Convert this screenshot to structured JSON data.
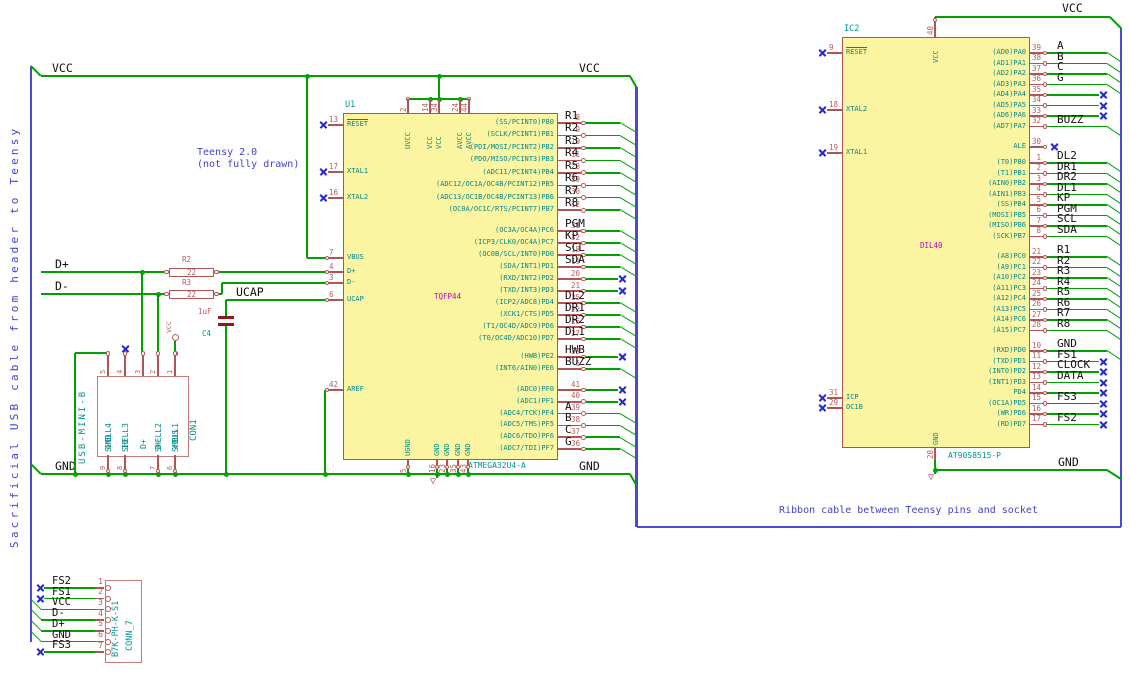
{
  "notes": {
    "sacrificial": "Sacrificial USB cable from header to Teensy",
    "teensy1": "Teensy 2.0",
    "teensy2": "(not fully drawn)",
    "ribbon": "Ribbon cable between Teensy pins and socket"
  },
  "nets": {
    "vcc": "VCC",
    "gnd": "GND",
    "dplus": "D+",
    "dminus": "D-",
    "ucap": "UCAP"
  },
  "colors": {
    "wire_green": "#00A000",
    "bus_blue": "#4A4AD2",
    "body_fill": "#FBF4A1",
    "outline_red": "#B05555",
    "pin_number_red": "#B85A5A",
    "pin_name_teal": "#008B8B",
    "reference_cyan": "#009494",
    "package_magenta": "#BF00BF",
    "note_blue": "#4343CC",
    "net_label_black": "#101010",
    "no_connect_blue": "#2525D2"
  },
  "u1": {
    "ref": "U1",
    "part": "ATMEGA32U4-A",
    "package": "TQFP44",
    "top_pins": [
      {
        "n": "2",
        "name": "UVCC"
      },
      {
        "n": "14",
        "name": "VCC"
      },
      {
        "n": "34",
        "name": "VCC"
      },
      {
        "n": "24",
        "name": "AVCC"
      },
      {
        "n": "44",
        "name": "AVCC"
      }
    ],
    "bottom_pins": [
      {
        "n": "5",
        "name": "UGND"
      },
      {
        "n": "16",
        "name": "GND"
      },
      {
        "n": "23",
        "name": "GND"
      },
      {
        "n": "35",
        "name": "GND"
      },
      {
        "n": "43",
        "name": "GND"
      }
    ],
    "left_pins": [
      {
        "n": "13",
        "name": "RESET",
        "conn": "nc",
        "ovl": true
      },
      {
        "n": "17",
        "name": "XTAL1",
        "conn": "nc"
      },
      {
        "n": "16",
        "name": "XTAL2",
        "conn": "nc"
      },
      {
        "n": "7",
        "name": "VBUS",
        "conn": "wire"
      },
      {
        "n": "4",
        "name": "D+",
        "conn": "wire"
      },
      {
        "n": "3",
        "name": "D-",
        "conn": "wire"
      },
      {
        "n": "6",
        "name": "UCAP",
        "conn": "wire"
      },
      {
        "n": "42",
        "name": "AREF",
        "conn": "wire"
      }
    ],
    "right_groups": [
      [
        {
          "n": "8",
          "name": "(SS/PCINT0)PB0",
          "net": "R1",
          "conn": "bus"
        },
        {
          "n": "9",
          "name": "(SCLK/PCINT1)PB1",
          "net": "R2",
          "conn": "bus"
        },
        {
          "n": "10",
          "name": "(PDI/MOSI/PCINT2)PB2",
          "net": "R3",
          "conn": "bus"
        },
        {
          "n": "11",
          "name": "(PDO/MISO/PCINT3)PB3",
          "net": "R4",
          "conn": "bus"
        },
        {
          "n": "28",
          "name": "(ADC11/PCINT4)PB4",
          "net": "R5",
          "conn": "bus"
        },
        {
          "n": "29",
          "name": "(ADC12/OC1A/OC4B/PCINT12)PB5",
          "net": "R6",
          "conn": "bus"
        },
        {
          "n": "30",
          "name": "(ADC13/OC1B/OC4B/PCINT13)PB6",
          "net": "R7",
          "conn": "bus"
        },
        {
          "n": "12",
          "name": "(OC0A/OC1C/RTS/PCINT7)PB7",
          "net": "R8",
          "conn": "bus"
        }
      ],
      [
        {
          "n": "31",
          "name": "(OC3A/OC4A)PC6",
          "net": "PGM",
          "conn": "bus"
        },
        {
          "n": "32",
          "name": "(ICP3/CLK0/OC4A)PC7",
          "net": "KP",
          "conn": "bus"
        }
      ],
      [
        {
          "n": "18",
          "name": "(OC0B/SCL/INT0)PD0",
          "net": "SCL",
          "conn": "bus"
        },
        {
          "n": "19",
          "name": "(SDA/INT1)PD1",
          "net": "SDA",
          "conn": "bus"
        },
        {
          "n": "20",
          "name": "(RXD/INT2)PD2",
          "net": "",
          "conn": "nc"
        },
        {
          "n": "21",
          "name": "(TXD/INT3)PD3",
          "net": "",
          "conn": "nc"
        },
        {
          "n": "25",
          "name": "(ICP2/ADC8)PD4",
          "net": "DL2",
          "conn": "bus"
        },
        {
          "n": "22",
          "name": "(XCK1/CTS)PD5",
          "net": "DR1",
          "conn": "bus"
        },
        {
          "n": "26",
          "name": "(T1/OC4D/ADC9)PD6",
          "net": "DR2",
          "conn": "bus"
        },
        {
          "n": "27",
          "name": "(T0/OC4D/ADC10)PD7",
          "net": "DL1",
          "conn": "bus"
        }
      ],
      [
        {
          "n": "33",
          "name": "(HWB)PE2",
          "net": "HWB",
          "conn": "nc"
        },
        {
          "n": "1",
          "name": "(INT6/AIN0)PE6",
          "net": "BUZZ",
          "conn": "bus"
        }
      ],
      [
        {
          "n": "41",
          "name": "(ADC0)PF0",
          "net": "",
          "conn": "nc"
        },
        {
          "n": "40",
          "name": "(ADC1)PF1",
          "net": "",
          "conn": "nc"
        },
        {
          "n": "39",
          "name": "(ADC4/TCK)PF4",
          "net": "A",
          "conn": "bus"
        },
        {
          "n": "38",
          "name": "(ADC5/TMS)PF5",
          "net": "B",
          "conn": "bus"
        },
        {
          "n": "37",
          "name": "(ADC6/TDO)PF6",
          "net": "C",
          "conn": "bus"
        },
        {
          "n": "36",
          "name": "(ADC7/TDI)PF7",
          "net": "G",
          "conn": "bus"
        }
      ]
    ]
  },
  "ic2": {
    "ref": "IC2",
    "part": "AT90S8515-P",
    "package": "DIL40",
    "top_pins": [
      {
        "n": "40",
        "name": "VCC"
      }
    ],
    "bottom_pins": [
      {
        "n": "20",
        "name": "GND"
      }
    ],
    "left_pins": [
      {
        "n": "9",
        "name": "RESET",
        "conn": "nc",
        "ovl": true
      },
      {
        "n": "18",
        "name": "XTAL2",
        "conn": "nc"
      },
      {
        "n": "19",
        "name": "XTAL1",
        "conn": "nc"
      },
      {
        "n": "31",
        "name": "ICP",
        "conn": "nc"
      },
      {
        "n": "29",
        "name": "OC1B",
        "conn": "nc"
      }
    ],
    "right_groups": [
      [
        {
          "n": "39",
          "name": "(AD0)PA0",
          "net": "A",
          "conn": "bus"
        },
        {
          "n": "38",
          "name": "(AD1)PA1",
          "net": "B",
          "conn": "bus"
        },
        {
          "n": "37",
          "name": "(AD2)PA2",
          "net": "C",
          "conn": "bus"
        },
        {
          "n": "36",
          "name": "(AD3)PA3",
          "net": "G",
          "conn": "bus"
        },
        {
          "n": "35",
          "name": "(AD4)PA4",
          "net": "",
          "conn": "nc"
        },
        {
          "n": "34",
          "name": "(AD5)PA5",
          "net": "",
          "conn": "nc"
        },
        {
          "n": "33",
          "name": "(AD6)PA6",
          "net": "",
          "conn": "nc"
        },
        {
          "n": "32",
          "name": "(AD7)PA7",
          "net": "BUZZ",
          "conn": "bus"
        }
      ],
      [
        {
          "n": "30",
          "name": "ALE",
          "net": "",
          "conn": "ncshort"
        }
      ],
      [
        {
          "n": "1",
          "name": "(T0)PB0",
          "net": "DL2",
          "conn": "bus"
        },
        {
          "n": "2",
          "name": "(T1)PB1",
          "net": "DR1",
          "conn": "bus"
        },
        {
          "n": "3",
          "name": "(AIN0)PB2",
          "net": "DR2",
          "conn": "bus"
        },
        {
          "n": "4",
          "name": "(AIN1)PB3",
          "net": "DL1",
          "conn": "bus"
        },
        {
          "n": "5",
          "name": "(SS)PB4",
          "net": "KP",
          "conn": "bus"
        },
        {
          "n": "6",
          "name": "(MOSI)PB5",
          "net": "PGM",
          "conn": "bus"
        },
        {
          "n": "7",
          "name": "(MISO)PB6",
          "net": "SCL",
          "conn": "bus"
        },
        {
          "n": "8",
          "name": "(SCK)PB7",
          "net": "SDA",
          "conn": "bus"
        }
      ],
      [
        {
          "n": "21",
          "name": "(A8)PC0",
          "net": "R1",
          "conn": "bus"
        },
        {
          "n": "22",
          "name": "(A9)PC1",
          "net": "R2",
          "conn": "bus"
        },
        {
          "n": "23",
          "name": "(A10)PC2",
          "net": "R3",
          "conn": "bus"
        },
        {
          "n": "24",
          "name": "(A11)PC3",
          "net": "R4",
          "conn": "bus"
        },
        {
          "n": "25",
          "name": "(A12)PC4",
          "net": "R5",
          "conn": "bus"
        },
        {
          "n": "26",
          "name": "(A13)PC5",
          "net": "R6",
          "conn": "bus"
        },
        {
          "n": "27",
          "name": "(A14)PC6",
          "net": "R7",
          "conn": "bus"
        },
        {
          "n": "28",
          "name": "(A15)PC7",
          "net": "R8",
          "conn": "bus"
        }
      ],
      [
        {
          "n": "10",
          "name": "(RXD)PD0",
          "net": "GND",
          "conn": "bus"
        },
        {
          "n": "11",
          "name": "(TXD)PD1",
          "net": "FS1",
          "conn": "nc"
        },
        {
          "n": "12",
          "name": "(INT0)PD2",
          "net": "CLOCK",
          "conn": "nc"
        },
        {
          "n": "13",
          "name": "(INT1)PD3",
          "net": "DATA",
          "conn": "nc"
        },
        {
          "n": "14",
          "name": "PD4",
          "net": "",
          "conn": "nc"
        },
        {
          "n": "15",
          "name": "(OC1A)PD5",
          "net": "FS3",
          "conn": "nc"
        },
        {
          "n": "16",
          "name": "(WR)PD6",
          "net": "",
          "conn": "nc"
        },
        {
          "n": "17",
          "name": "(RD)PD7",
          "net": "FS2",
          "conn": "nc"
        }
      ]
    ]
  },
  "usb": {
    "ref": "CON1",
    "part": "USB-MINI-B",
    "top_pins": [
      {
        "n": "5",
        "name": "GND"
      },
      {
        "n": "4",
        "name": "ID"
      },
      {
        "n": "3",
        "name": "D+"
      },
      {
        "n": "2",
        "name": "D-"
      },
      {
        "n": "1",
        "name": "VBUS"
      }
    ],
    "bottom_pins": [
      {
        "n": "9",
        "name": "SHELL4"
      },
      {
        "n": "8",
        "name": "SHELL3"
      },
      {
        "n": "7",
        "name": "SHELL2"
      },
      {
        "n": "6",
        "name": "SHELL1"
      }
    ]
  },
  "conn7": {
    "ref": "CONN_7",
    "part": "B7K-PH-K-S1",
    "pins": [
      {
        "n": "1",
        "net": "FS2",
        "conn": "nc"
      },
      {
        "n": "2",
        "net": "FS1",
        "conn": "nc"
      },
      {
        "n": "3",
        "net": "VCC",
        "conn": "bus"
      },
      {
        "n": "4",
        "net": "D-",
        "conn": "bus"
      },
      {
        "n": "5",
        "net": "D+",
        "conn": "bus"
      },
      {
        "n": "6",
        "net": "GND",
        "conn": "bus"
      },
      {
        "n": "7",
        "net": "FS3",
        "conn": "nc"
      }
    ]
  },
  "r2": {
    "ref": "R2",
    "value": "22"
  },
  "r3": {
    "ref": "R3",
    "value": "22"
  },
  "c4": {
    "ref": "C4",
    "value": "1uF"
  }
}
